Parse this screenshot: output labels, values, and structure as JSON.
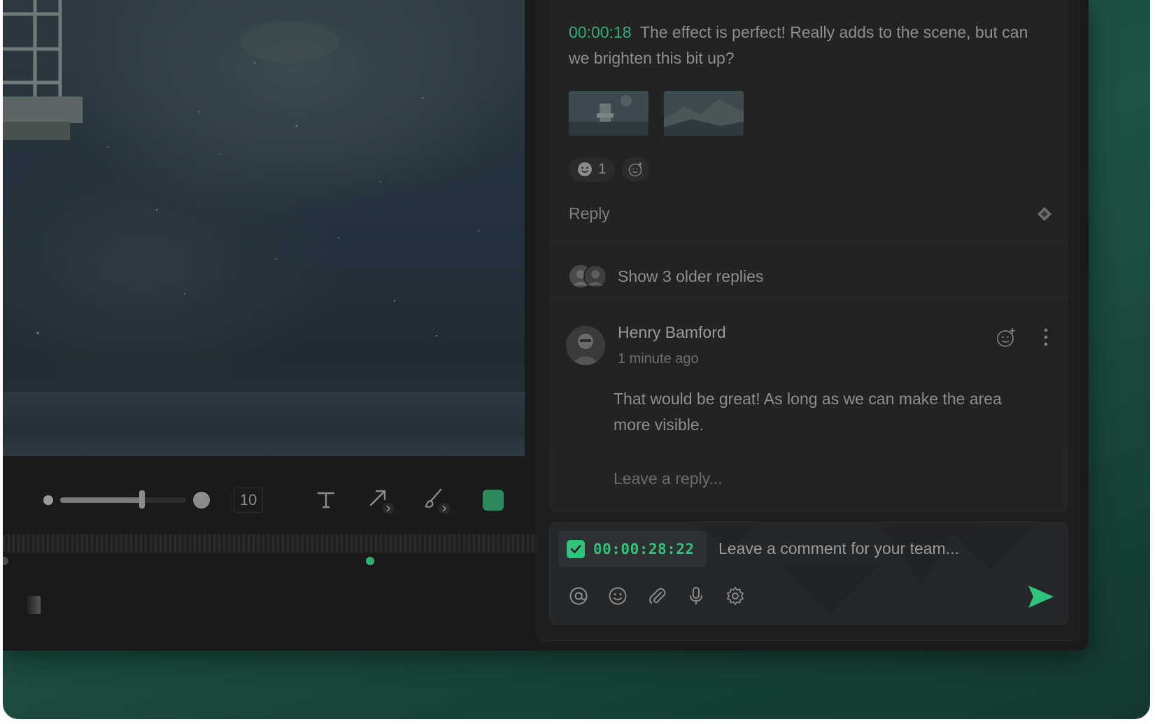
{
  "toolbar": {
    "brush_size": "10",
    "color_swatch": "#2a8a5c",
    "brush_level": 0.65
  },
  "thread": {
    "comment": {
      "timecode": "00:00:18",
      "text": "The effect is perfect! Really adds to the scene, but can we brighten this bit up?",
      "reaction_count": "1"
    },
    "reply_label": "Reply",
    "older_replies": "Show 3 older replies",
    "reply": {
      "author": "Henry Bamford",
      "time": "1 minute ago",
      "text": "That would be great! As long as we can make the area more visible."
    },
    "reply_placeholder": "Leave a reply..."
  },
  "composer": {
    "timecode": "00:00:28:22",
    "placeholder": "Leave a comment for your team...",
    "tools": [
      "at-icon",
      "emoji-icon",
      "paperclip-icon",
      "microphone-icon",
      "settings-icon"
    ],
    "send_color": "#2fc47c"
  },
  "colors": {
    "accent": "#2fae72",
    "background": "#1d5445"
  }
}
